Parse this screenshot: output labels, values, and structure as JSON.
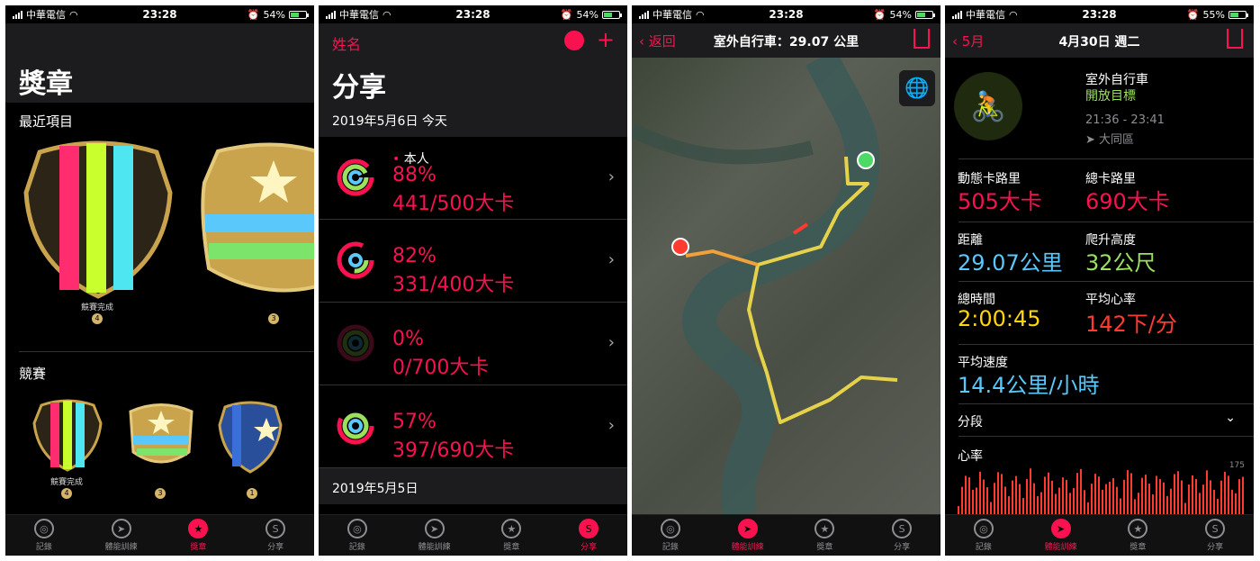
{
  "status": [
    {
      "carrier": "中華電信",
      "time": "23:28",
      "battery": "54%"
    },
    {
      "carrier": "中華電信",
      "time": "23:28",
      "battery": "54%"
    },
    {
      "carrier": "中華電信",
      "time": "23:28",
      "battery": "54%"
    },
    {
      "carrier": "中華電信",
      "time": "23:28",
      "battery": "55%"
    }
  ],
  "tabs": [
    "記錄",
    "體能訓練",
    "獎章",
    "分享"
  ],
  "awards": {
    "title": "獎章",
    "recent_label": "最近項目",
    "recent_items": [
      {
        "caption": "競賽完成",
        "count": "4"
      },
      {
        "caption": "",
        "count": "3"
      }
    ],
    "competition_label": "競賽",
    "competition_items": [
      {
        "caption": "競賽完成",
        "count": "4"
      },
      {
        "caption": "",
        "count": "3"
      },
      {
        "caption": "",
        "count": "1"
      }
    ]
  },
  "sharing": {
    "name_link": "姓名",
    "add_symbol": "+",
    "title": "分享",
    "today_header": "2019年5月6日 今天",
    "rows": [
      {
        "person": "本人",
        "percent": "88%",
        "kcal": "441/500大卡"
      },
      {
        "person": "",
        "percent": "82%",
        "kcal": "331/400大卡"
      },
      {
        "person": "",
        "percent": "0%",
        "kcal": "0/700大卡"
      },
      {
        "person": "",
        "percent": "57%",
        "kcal": "397/690大卡"
      }
    ],
    "prev_header": "2019年5月5日"
  },
  "route": {
    "back_label": "返回",
    "title": "室外自行車：29.07 公里"
  },
  "detail": {
    "back_label": "5月",
    "title": "4月30日 週二",
    "workout_name": "室外自行車",
    "goal": "開放目標",
    "time_range": "21:36 - 23:41",
    "location": "大同區",
    "metrics": [
      {
        "label": "動態卡路里",
        "value": "505大卡",
        "color": "#fa114f"
      },
      {
        "label": "總卡路里",
        "value": "690大卡",
        "color": "#fa114f"
      },
      {
        "label": "距離",
        "value": "29.07公里",
        "color": "#5ac8fa"
      },
      {
        "label": "爬升高度",
        "value": "32公尺",
        "color": "#9be15d"
      },
      {
        "label": "總時間",
        "value": "2:00:45",
        "color": "#ffd60a"
      },
      {
        "label": "平均心率",
        "value": "142下/分",
        "color": "#ff3b30"
      }
    ],
    "avg_speed_label": "平均速度",
    "avg_speed_value": "14.4公里/小時",
    "segments_label": "分段",
    "heart_label": "心率",
    "heart_max": "175"
  }
}
